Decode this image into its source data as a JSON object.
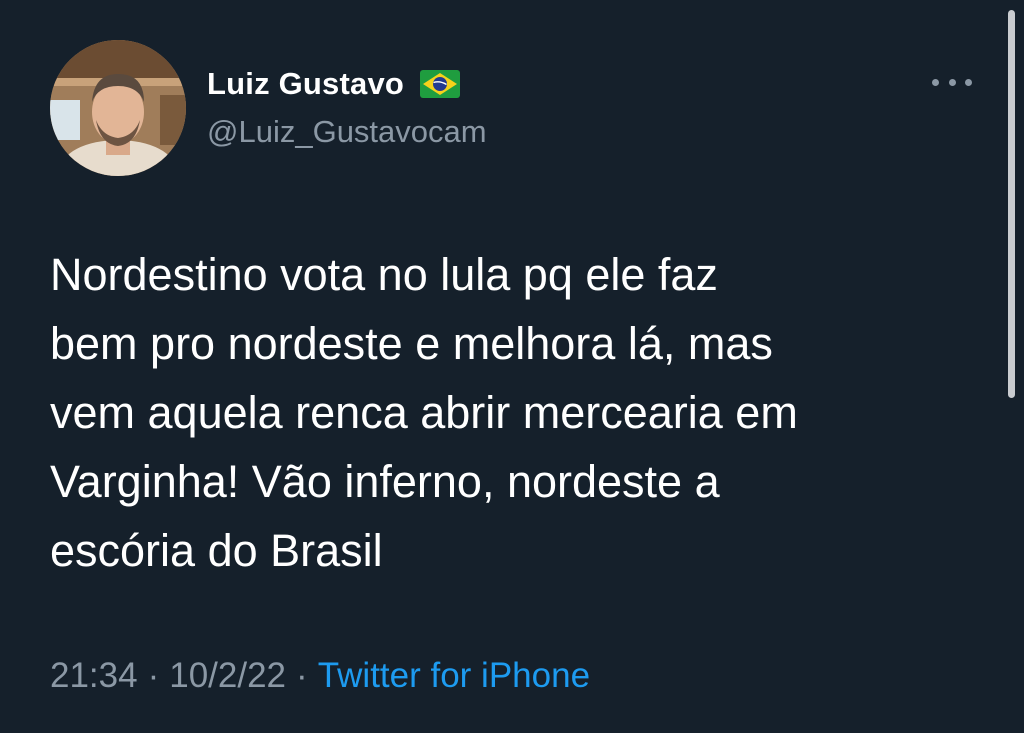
{
  "user": {
    "display_name": "Luiz Gustavo",
    "flag_icon": "brazil-flag-icon",
    "handle": "@Luiz_Gustavocam"
  },
  "tweet": {
    "lines": [
      "Nordestino vota no lula pq ele faz",
      "bem pro nordeste e melhora lá, mas",
      "vem aquela renca abrir mercearia em",
      "Varginha! Vão inferno, nordeste a",
      "escória do Brasil"
    ]
  },
  "meta": {
    "time": "21:34",
    "separator": "·",
    "date": "10/2/22",
    "source": "Twitter for iPhone"
  },
  "colors": {
    "background": "#15202b",
    "secondary_text": "#8b98a5",
    "link": "#1d9bf0"
  }
}
